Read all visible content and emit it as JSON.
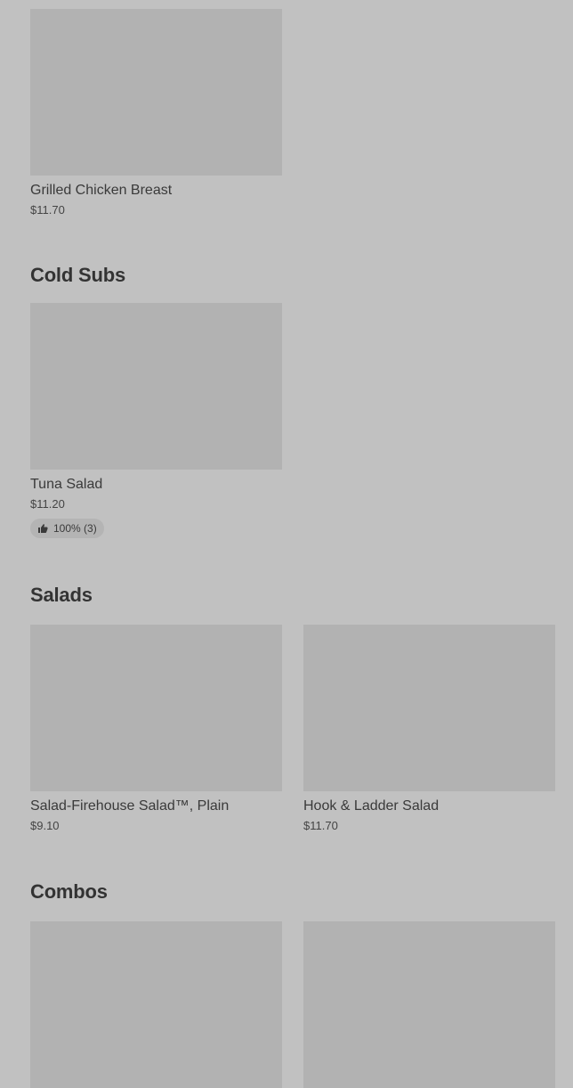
{
  "sections": [
    {
      "title": "",
      "items": [
        {
          "name": "Grilled Chicken Breast",
          "price": "$11.70"
        }
      ]
    },
    {
      "title": "Cold Subs",
      "items": [
        {
          "name": "Tuna Salad",
          "price": "$11.20",
          "rating": "100% (3)",
          "rating_icon": "thumbs-up-icon"
        }
      ]
    },
    {
      "title": "Salads",
      "items": [
        {
          "name": "Salad-Firehouse Salad™, Plain",
          "price": "$9.10"
        },
        {
          "name": "Hook & Ladder Salad",
          "price": "$11.70"
        }
      ]
    },
    {
      "title": "Combos",
      "items": [
        {
          "name": "",
          "price": ""
        },
        {
          "name": "",
          "price": ""
        }
      ]
    }
  ],
  "colors": {
    "background": "#c1c1c1",
    "image_placeholder": "#b2b2b2",
    "text": "#3a3a3a"
  }
}
